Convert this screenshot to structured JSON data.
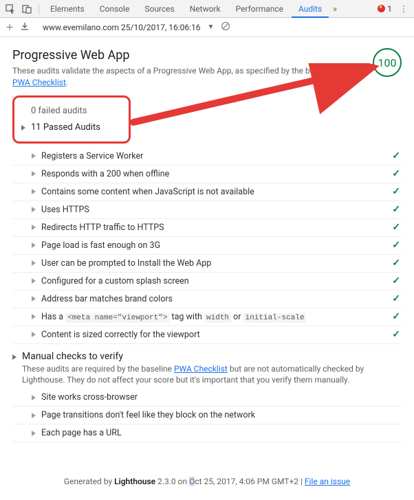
{
  "tabs": {
    "elements": "Elements",
    "console": "Console",
    "sources": "Sources",
    "network": "Network",
    "performance": "Performance",
    "audits": "Audits",
    "more": "»",
    "error_count": "1"
  },
  "toolbar": {
    "url_line": "www.evemilano.com 25/10/2017, 16:06:16"
  },
  "header": {
    "title": "Progressive Web App",
    "desc_prefix": "These audits validate the aspects of a Progressive Web App, as specified by the baseline ",
    "desc_link": "PWA Checklist",
    "desc_suffix": ".",
    "score": "100"
  },
  "summary": {
    "failed": "0 failed audits",
    "passed": "11 Passed Audits"
  },
  "passed_audits": [
    "Registers a Service Worker",
    "Responds with a 200 when offline",
    "Contains some content when JavaScript is not available",
    "Uses HTTPS",
    "Redirects HTTP traffic to HTTPS",
    "Page load is fast enough on 3G",
    "User can be prompted to Install the Web App",
    "Configured for a custom splash screen",
    "Address bar matches brand colors",
    "",
    "Content is sized correctly for the viewport"
  ],
  "viewport_audit": {
    "p1": "Has a ",
    "c1": "<meta name=\"viewport\">",
    "p2": " tag with ",
    "c2": "width",
    "p3": " or ",
    "c3": "initial-scale"
  },
  "manual": {
    "title": "Manual checks to verify",
    "desc_p1": "These audits are required by the baseline ",
    "desc_link": "PWA Checklist",
    "desc_p2": " but are not automatically checked by Lighthouse. They do not affect your score but it's important that you verify them manually.",
    "items": [
      "Site works cross-browser",
      "Page transitions don't feel like they block on the network",
      "Each page has a URL"
    ]
  },
  "footer": {
    "p1": "Generated by ",
    "strong": "Lighthouse",
    "p2": " 2.3.0 on ",
    "hl": "O",
    "p3": "ct 25, 2017, 4:06 PM GMT+2 | ",
    "link": "File an issue"
  }
}
